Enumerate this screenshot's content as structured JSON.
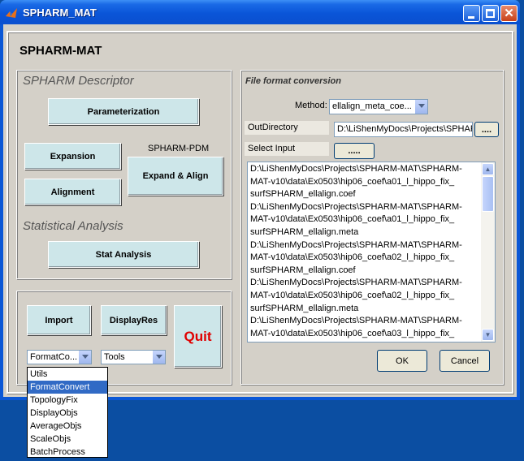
{
  "window": {
    "title": "SPHARM_MAT",
    "close_glyph": "✕"
  },
  "app": {
    "heading": "SPHARM-MAT"
  },
  "descriptor_panel": {
    "title": "SPHARM Descriptor",
    "parameterization_button": "Parameterization",
    "expansion_button": "Expansion",
    "alignment_button": "Alignment",
    "pdm_label": "SPHARM-PDM",
    "expand_align_button": "Expand & Align",
    "stats_title": "Statistical Analysis",
    "stat_analysis_button": "Stat Analysis"
  },
  "bottom_panel": {
    "import_button": "Import",
    "displayres_button": "DisplayRes",
    "quit_button": "Quit",
    "format_select_value": "FormatCo...",
    "tools_select_value": "Tools",
    "dropdown_options": [
      "Utils",
      "FormatConvert",
      "TopologyFix",
      "DisplayObjs",
      "AverageObjs",
      "ScaleObjs",
      "BatchProcess"
    ],
    "dropdown_selected": "FormatConvert"
  },
  "format_panel": {
    "title": "File format conversion",
    "method_label": "Method:",
    "method_value": "ellalign_meta_coe...",
    "outdir_label": "OutDirectory",
    "outdir_value": "D:\\LiShenMyDocs\\Projects\\SPHARI",
    "browse_label": "....",
    "select_input_label": "Select Input",
    "select_input_button": ".....",
    "input_list": [
      "D:\\LiShenMyDocs\\Projects\\SPHARM-MAT\\SPHARM-",
      "MAT-v10\\data\\Ex0503\\hip06_coef\\a01_l_hippo_fix_",
      "surfSPHARM_ellalign.coef",
      "D:\\LiShenMyDocs\\Projects\\SPHARM-MAT\\SPHARM-",
      "MAT-v10\\data\\Ex0503\\hip06_coef\\a01_l_hippo_fix_",
      "surfSPHARM_ellalign.meta",
      "D:\\LiShenMyDocs\\Projects\\SPHARM-MAT\\SPHARM-",
      "MAT-v10\\data\\Ex0503\\hip06_coef\\a02_l_hippo_fix_",
      "surfSPHARM_ellalign.coef",
      "D:\\LiShenMyDocs\\Projects\\SPHARM-MAT\\SPHARM-",
      "MAT-v10\\data\\Ex0503\\hip06_coef\\a02_l_hippo_fix_",
      "surfSPHARM_ellalign.meta",
      "D:\\LiShenMyDocs\\Projects\\SPHARM-MAT\\SPHARM-",
      "MAT-v10\\data\\Ex0503\\hip06_coef\\a03_l_hippo_fix_"
    ],
    "ok_button": "OK",
    "cancel_button": "Cancel"
  },
  "colors": {
    "titlebar": "#0a55d8",
    "button_face": "#cde6e9",
    "quit_text": "#e00000",
    "selection": "#316ac5"
  },
  "icons": {
    "app": "matlab-membrane-icon",
    "min": "minimize-icon",
    "max": "maximize-icon",
    "close": "close-icon"
  }
}
